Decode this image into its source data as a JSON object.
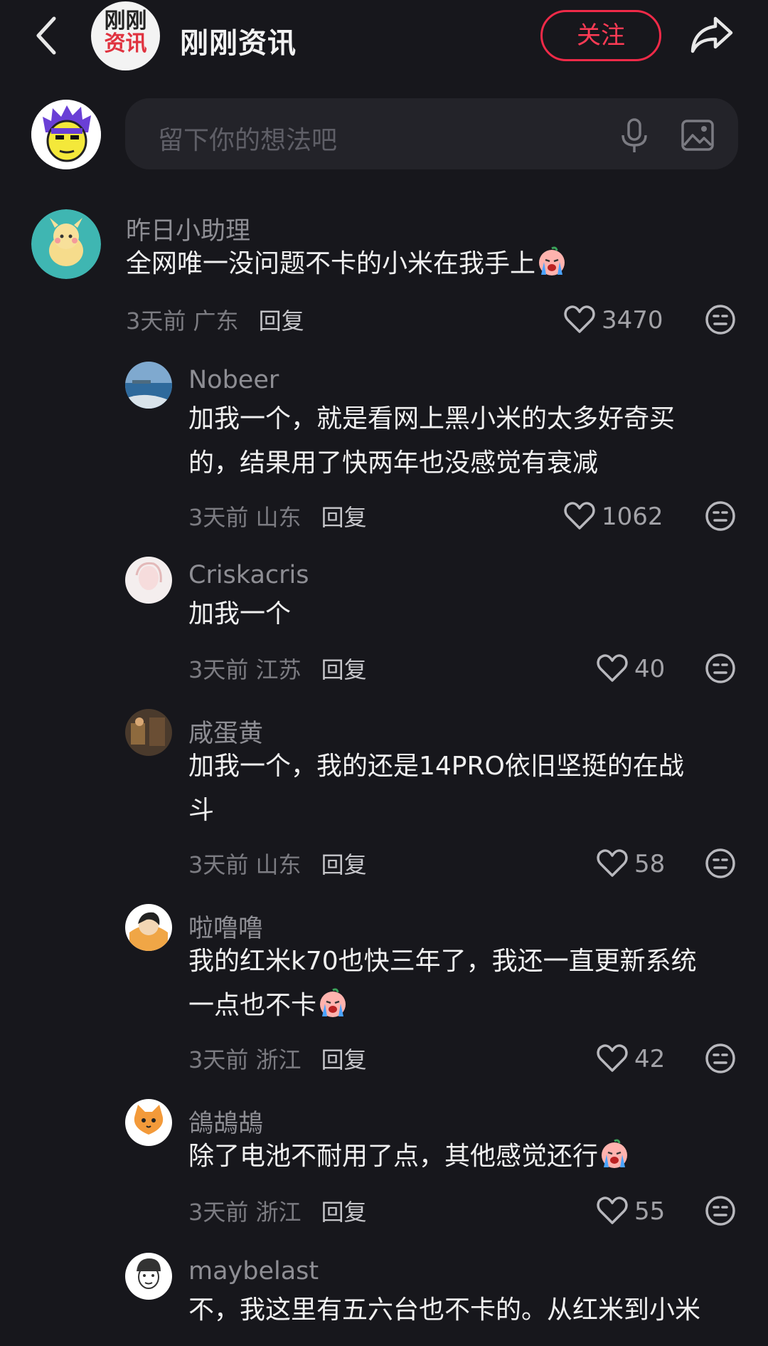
{
  "header": {
    "logo_line1": "刚刚",
    "logo_line2": "资讯",
    "account_name": "刚刚资讯",
    "follow_label": "关注"
  },
  "composer": {
    "placeholder": "留下你的想法吧"
  },
  "icons": {
    "back": "chevron-left-icon",
    "share": "share-arrow-icon",
    "mic": "microphone-icon",
    "image": "image-icon",
    "like": "heart-icon",
    "dislike": "meh-face-icon",
    "emoji": "crying-face-emoji"
  },
  "colors": {
    "background": "#17171c",
    "accent": "#f02a48"
  },
  "comments": [
    {
      "user": "昨日小助理",
      "text": "全网唯一没问题不卡的小米在我手上",
      "time": "3天前",
      "region": "广东",
      "reply": "回复",
      "likes": "3470"
    },
    {
      "user": "Nobeer",
      "text_line1": "加我一个，就是看网上黑小米的太多好奇买",
      "text_line2": "的，结果用了快两年也没感觉有衰减",
      "time": "3天前",
      "region": "山东",
      "reply": "回复",
      "likes": "1062"
    },
    {
      "user": "Criskacris",
      "text": "加我一个",
      "time": "3天前",
      "region": "江苏",
      "reply": "回复",
      "likes": "40"
    },
    {
      "user": "咸蛋黄",
      "text_line1": "加我一个，我的还是14PRO依旧坚挺的在战",
      "text_line2": "斗",
      "time": "3天前",
      "region": "山东",
      "reply": "回复",
      "likes": "58"
    },
    {
      "user": "啦噜噜",
      "text_line1": "我的红米k70也快三年了，我还一直更新系统",
      "text_line2": "一点也不卡",
      "time": "3天前",
      "region": "浙江",
      "reply": "回复",
      "likes": "42"
    },
    {
      "user": "鴿鴣鴣",
      "text": "除了电池不耐用了点，其他感觉还行",
      "time": "3天前",
      "region": "浙江",
      "reply": "回复",
      "likes": "55"
    },
    {
      "user": "maybelast",
      "text": "不，我这里有五六台也不卡的。从红米到小米"
    }
  ]
}
